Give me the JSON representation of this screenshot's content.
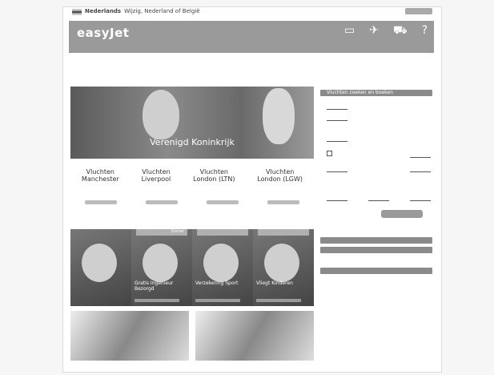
{
  "topbar": {
    "language_label": "Nederlands",
    "language_rest": "Wijzig",
    "country_label": "Nederland of België"
  },
  "header": {
    "logo": "easyJet",
    "icons": [
      {
        "name": "tv-icon",
        "glyph": "▭",
        "label": ""
      },
      {
        "name": "plane-icon",
        "glyph": "✈",
        "label": ""
      },
      {
        "name": "cart-icon",
        "glyph": "⛟",
        "label": ""
      },
      {
        "name": "help-icon",
        "glyph": "?",
        "label": ""
      }
    ]
  },
  "nav": [
    "",
    "",
    "",
    "",
    ""
  ],
  "hero": {
    "caption_small": "",
    "caption_big": "Verenigd Koninkrijk"
  },
  "destinations": [
    {
      "small": "Vluchten",
      "name": "Manchester"
    },
    {
      "small": "Vluchten",
      "name": "Liverpool"
    },
    {
      "small": "Vluchten",
      "name": "London (LTN)"
    },
    {
      "small": "Vluchten",
      "name": "London (LGW)"
    }
  ],
  "description": "",
  "cards": [
    {
      "badge": "",
      "title": ""
    },
    {
      "badge": "Zomer",
      "title": "Gratis Ingenieur Bezorgd"
    },
    {
      "badge": "",
      "title": "Verzekering Sport"
    },
    {
      "badge": "",
      "title": "Vliegt Kinderen"
    }
  ],
  "sidebar": {
    "search_title": "Vluchten zoeken en boeken",
    "bar_2": "",
    "bar_3": "",
    "bar_4": ""
  }
}
